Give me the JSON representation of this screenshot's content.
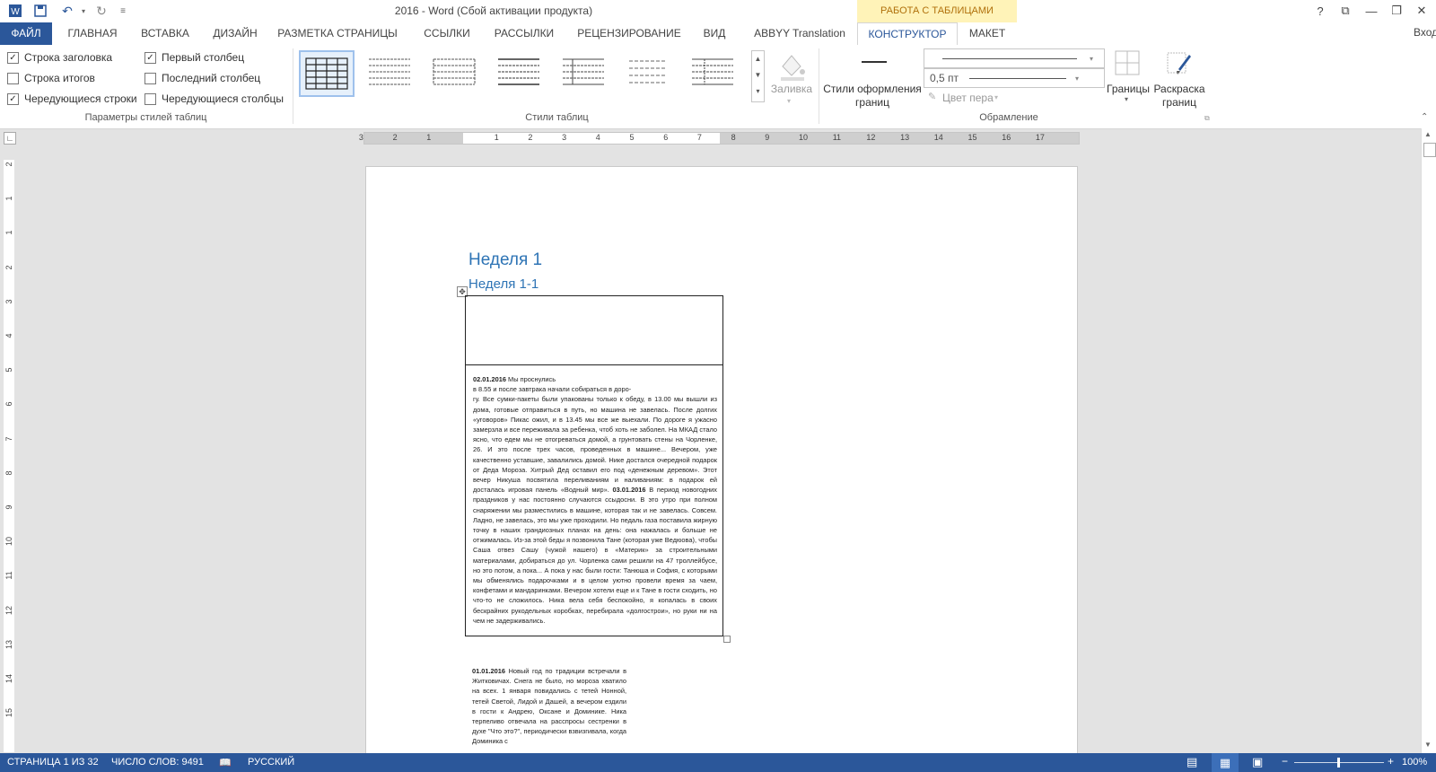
{
  "titlebar": {
    "title": "2016 - Word (Сбой активации продукта)",
    "context_header": "РАБОТА С ТАБЛИЦАМИ",
    "help": "?",
    "ribbon_options": "⧉",
    "minimize": "—",
    "restore": "❐",
    "close": "✕"
  },
  "tabs": {
    "file": "ФАЙЛ",
    "home": "ГЛАВНАЯ",
    "insert": "ВСТАВКА",
    "design": "ДИЗАЙН",
    "layout_page": "РАЗМЕТКА СТРАНИЦЫ",
    "references": "ССЫЛКИ",
    "mailings": "РАССЫЛКИ",
    "review": "РЕЦЕНЗИРОВАНИЕ",
    "view": "ВИД",
    "abbyy": "ABBYY Translation",
    "constructor": "КОНСТРУКТОР",
    "maket": "МАКЕТ",
    "user": "Вход"
  },
  "ribbon": {
    "style_options": {
      "header_row": "Строка заголовка",
      "first_column": "Первый столбец",
      "total_row": "Строка итогов",
      "last_column": "Последний столбец",
      "banded_rows": "Чередующиеся строки",
      "banded_columns": "Чередующиеся столбцы",
      "group_label": "Параметры стилей таблиц",
      "checked": {
        "header_row": "✓",
        "first_column": "✓",
        "total_row": "",
        "last_column": "",
        "banded_rows": "✓",
        "banded_columns": ""
      }
    },
    "styles": {
      "group_label": "Стили таблиц",
      "shading": "Заливка"
    },
    "borders": {
      "border_styles": "Стили оформления",
      "border_styles_2": "границ",
      "pen_weight": "0,5 пт",
      "pen_color": "Цвет пера",
      "borders_btn": "Границы",
      "painter": "Раскраска",
      "painter_2": "границ",
      "group_label": "Обрамление"
    }
  },
  "ruler": {
    "h_labels": [
      "3",
      "2",
      "1",
      "1",
      "2",
      "3",
      "4",
      "5",
      "6",
      "7",
      "8",
      "9",
      "10",
      "11",
      "12",
      "13",
      "14",
      "15",
      "16",
      "17"
    ],
    "v_labels": [
      "2",
      "1",
      "1",
      "2",
      "3",
      "4",
      "5",
      "6",
      "7",
      "8",
      "9",
      "10",
      "11",
      "12",
      "13",
      "14",
      "15"
    ]
  },
  "document": {
    "heading1": "Неделя 1",
    "heading2": "Неделя 1-1",
    "cell_date1": "02.01.2016",
    "cell_p1a": " Мы проснулись",
    "cell_p1b": "в 8.55 и после завтрака начали собираться в доро-",
    "cell_p1c": "гу. Все сумки-пакеты были упакованы только к обеду, в 13.00 мы вышли из дома, готовые отправиться в путь, но машина не завелась. После долгих «уговоров» Пикас ожил, и в 13.45 мы все же выехали. По дороге я ужасно замерзла и все переживала за ребенка, чтоб хоть не заболел. На МКАД стало ясно, что едем мы не отогреваться домой, а грунтовать стены на Чорленке, 26. И это после трех часов, проведенных в машине... Вечером, уже качественно уставшие, завалились домой. Нике достался очередной подарок от Деда Мороза. Хитрый Дед оставил его под «денежным деревом». Этот вечер Никуша посвятила переливаниям и наливаниям: в подарок ей досталась игровая панель «Водный мир». ",
    "cell_date2": "03.01.2016",
    "cell_p2": " В период новогодних праздников у нас постоянно случаются ссыдосни. В это утро при полном снаряжении мы разместились в машине, которая так и не завелась. Совсем. Ладно, не завелась, это мы уже проходили. Но педаль газа поставила жирную точку в наших грандиозных планах на день: она нажалась и больше не отжималась. Из-за этой беды я позвонила Тане (которая уже Ведюова), чтобы Саша отвез Сашу (чужой нашего) в «Материк» за строительными материалами, добираться до ул. Чорленка сами решили на 47 троллейбусе, но это потом, а пока... А пока у нас были гости: Танюша и София, с которыми мы обменялись подарочками и в целом уютно провели время за чаем, конфетами и мандаринками. Вечером хотели еще и к Тане в гости сходить, но что-то не сложилось. Ника вела себя беспокойно, я копалась в своих бескрайних рукодельных коробках, перебирала «долгострои», но руки ни на чем не задерживались.",
    "col_date": "01.01.2016",
    "col_p": " Новый год по традиции встречали в Житковичах. Снега не было, но мороза хватило на всех. 1 января повидались с тетей Нонной, тетей Светой, Лидой и Дашей, а вечером ездили в гости к Андрею, Оксане и Доминике. Ника терпеливо отвечала на расспросы сестренки в духе \"Что это?\", периодически взвизгивала, когда Доминика с"
  },
  "statusbar": {
    "page": "СТРАНИЦА 1 ИЗ 32",
    "words": "ЧИСЛО СЛОВ: 9491",
    "language": "РУССКИЙ",
    "zoom": "100%",
    "zoom_minus": "−",
    "zoom_plus": "+"
  }
}
